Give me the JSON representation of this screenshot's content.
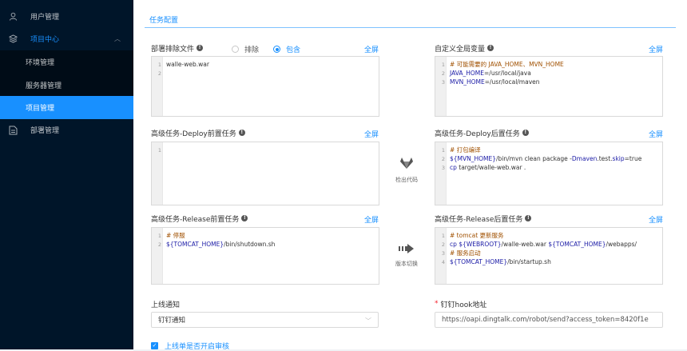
{
  "sidebar": {
    "items": [
      {
        "label": "用户管理",
        "icon": "user-icon"
      },
      {
        "label": "项目中心",
        "icon": "appstore-icon",
        "open": true
      },
      {
        "label": "环境管理"
      },
      {
        "label": "服务器管理"
      },
      {
        "label": "项目管理",
        "active": true
      },
      {
        "label": "部署管理",
        "icon": "file-icon"
      }
    ]
  },
  "page": {
    "title": "任务配置",
    "fullscreen_label": "全屏",
    "exclude_files": {
      "label": "部署排除文件",
      "options": [
        "排除",
        "包含"
      ],
      "selected": "包含",
      "lines": [
        "walle-web.war",
        ""
      ]
    },
    "global_vars": {
      "label": "自定义全局变量",
      "lines": [
        [
          {
            "t": "# 可能需要的 JAVA_HOME、MVN_HOME",
            "c": "comment"
          }
        ],
        [
          {
            "t": "JAVA_HOME",
            "c": "var"
          },
          {
            "t": "=/usr/local/java",
            "c": "plain"
          }
        ],
        [
          {
            "t": "MVN_HOME",
            "c": "var"
          },
          {
            "t": "=/usr/local/maven",
            "c": "plain"
          }
        ]
      ]
    },
    "pre_deploy": {
      "label": "高级任务-Deploy前置任务",
      "lines": [
        [
          {
            "t": "",
            "c": "plain"
          }
        ]
      ]
    },
    "post_deploy": {
      "label": "高级任务-Deploy后置任务",
      "lines": [
        [
          {
            "t": "# 打包编译",
            "c": "comment"
          }
        ],
        [
          {
            "t": "${MVN_HOME}",
            "c": "var"
          },
          {
            "t": "/bin/mvn clean package -",
            "c": "plain"
          },
          {
            "t": "Dmaven",
            "c": "var"
          },
          {
            "t": ".test.",
            "c": "plain"
          },
          {
            "t": "skip",
            "c": "var"
          },
          {
            "t": "=true",
            "c": "plain"
          }
        ],
        [
          {
            "t": "cp",
            "c": "var"
          },
          {
            "t": " target/walle-web.war .",
            "c": "plain"
          }
        ]
      ]
    },
    "checkout_action": {
      "label": "检出代码",
      "icon": "gitlab-icon"
    },
    "pre_release": {
      "label": "高级任务-Release前置任务",
      "lines": [
        [
          {
            "t": "# 停服",
            "c": "comment"
          }
        ],
        [
          {
            "t": "${TOMCAT_HOME}",
            "c": "var"
          },
          {
            "t": "/bin/shutdown.sh",
            "c": "plain"
          }
        ]
      ]
    },
    "switch_action": {
      "label": "版本切换",
      "icon": "switch-arrow-icon"
    },
    "post_release": {
      "label": "高级任务-Release后置任务",
      "lines": [
        [
          {
            "t": "# tomcat 更新服务",
            "c": "comment"
          }
        ],
        [
          {
            "t": "cp",
            "c": "var"
          },
          {
            "t": " ",
            "c": "plain"
          },
          {
            "t": "${WEBROOT}",
            "c": "var"
          },
          {
            "t": "/walle-web.war ",
            "c": "plain"
          },
          {
            "t": "${TOMCAT_HOME}",
            "c": "var"
          },
          {
            "t": "/webapps/",
            "c": "plain"
          }
        ],
        [
          {
            "t": "# 服务启动",
            "c": "comment"
          }
        ],
        [
          {
            "t": "${TOMCAT_HOME}",
            "c": "var"
          },
          {
            "t": "/bin/startup.sh",
            "c": "plain"
          }
        ]
      ]
    },
    "notify": {
      "label": "上线通知",
      "value": "钉钉通知"
    },
    "hook": {
      "required_mark": "*",
      "label": "钉钉hook地址",
      "value": "https://oapi.dingtalk.com/robot/send?access_token=8420f1e"
    },
    "audit": {
      "label": "上线单是否开启审核",
      "checked": true
    }
  },
  "colors": {
    "primary": "#1890ff",
    "sidebar": "#001529",
    "comment": "#a05000",
    "variable": "#1a1aa6"
  }
}
